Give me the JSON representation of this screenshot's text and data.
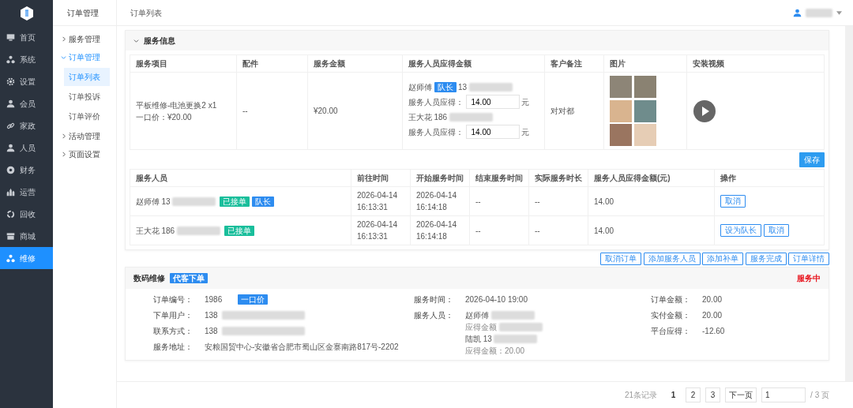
{
  "sidebar": {
    "items": [
      {
        "label": "首页",
        "selected": false
      },
      {
        "label": "系统",
        "selected": false
      },
      {
        "label": "设置",
        "selected": false
      },
      {
        "label": "会员",
        "selected": false
      },
      {
        "label": "家政",
        "selected": false
      },
      {
        "label": "人员",
        "selected": false
      },
      {
        "label": "财务",
        "selected": false
      },
      {
        "label": "运营",
        "selected": false
      },
      {
        "label": "回收",
        "selected": false
      },
      {
        "label": "商城",
        "selected": false
      },
      {
        "label": "维修",
        "selected": true
      }
    ]
  },
  "submenu": {
    "title": "订单管理",
    "groups": [
      {
        "label": "服务管理",
        "expanded": false
      },
      {
        "label": "订单管理",
        "expanded": true,
        "children": [
          {
            "label": "订单列表",
            "selected": true
          },
          {
            "label": "订单投诉",
            "selected": false
          },
          {
            "label": "订单评价",
            "selected": false
          }
        ]
      },
      {
        "label": "活动管理",
        "expanded": false
      },
      {
        "label": "页面设置",
        "expanded": false
      }
    ]
  },
  "breadcrumb": "订单列表",
  "user": {
    "redacted": true
  },
  "service_info": {
    "title": "服务信息",
    "expanded": true,
    "items_table": {
      "columns": [
        "服务项目",
        "配件",
        "服务金额",
        "服务人员应得金额",
        "客户备注",
        "图片",
        "安装视频"
      ],
      "row": {
        "item": "平板维修-电池更换2 x1",
        "price": "一口价：¥20.00",
        "parts": "--",
        "amount": "¥20.00",
        "note": "对对都",
        "earnings": [
          {
            "name": "赵师傅",
            "leader": true,
            "leader_label": "队长",
            "phone": "13",
            "redacted": true,
            "label": "服务人员应得：",
            "value": "14.00",
            "unit": "元"
          },
          {
            "name": "王大花",
            "leader": false,
            "phone": "186",
            "redacted": true,
            "label": "服务人员应得：",
            "value": "14.00",
            "unit": "元"
          }
        ]
      }
    },
    "save_button": "保存",
    "staff_table": {
      "columns": [
        "服务人员",
        "前往时间",
        "开始服务时间",
        "结束服务时间",
        "实际服务时长",
        "服务人员应得金额(元)",
        "操作"
      ],
      "rows": [
        {
          "name": "赵师傅",
          "phone": "13",
          "redacted": true,
          "tags": [
            {
              "label": "已接单",
              "kind": "accepted"
            },
            {
              "label": "队长",
              "kind": "leader"
            }
          ],
          "depart": [
            "2026-04-14",
            "16:13:31"
          ],
          "start": [
            "2026-04-14",
            "16:14:18"
          ],
          "end": "--",
          "duration": "--",
          "earn": "14.00",
          "actions": [
            "取消"
          ]
        },
        {
          "name": "王大花",
          "phone": "186",
          "redacted": true,
          "tags": [
            {
              "label": "已接单",
              "kind": "accepted"
            }
          ],
          "depart": [
            "2026-04-14",
            "16:13:31"
          ],
          "start": [
            "2026-04-14",
            "16:14:18"
          ],
          "end": "--",
          "duration": "--",
          "earn": "14.00",
          "actions": [
            "设为队长",
            "取消"
          ]
        }
      ]
    }
  },
  "order_actions": [
    "取消订单",
    "添加服务人员",
    "添加补单",
    "服务完成",
    "订单详情"
  ],
  "order": {
    "category": "数码维修",
    "tag": "代客下单",
    "status": "服务中",
    "col1": [
      {
        "label": "订单编号：",
        "value": "1986",
        "badge": "一口价"
      },
      {
        "label": "下单用户：",
        "value": "138",
        "redacted": true
      },
      {
        "label": "联系方式：",
        "value": "138",
        "redacted": true
      },
      {
        "label": "服务地址：",
        "value": "安粮国贸中心-安徽省合肥市蜀山区金寨南路817号-2202"
      }
    ],
    "col2": [
      {
        "label": "服务时间：",
        "lines": [
          {
            "text": "2026-04-10 19:00"
          }
        ]
      },
      {
        "label": "服务人员：",
        "lines": [
          {
            "text": "赵师傅",
            "redacted": true
          },
          {
            "text": "应得金额",
            "redacted": true,
            "muted": true
          },
          {
            "text": "陆凯  13",
            "redacted": true
          },
          {
            "text": "应得金额：20.00",
            "muted": true
          }
        ]
      }
    ],
    "col3": [
      {
        "label": "订单金额：",
        "value": "20.00"
      },
      {
        "label": "实付金额：",
        "value": "20.00"
      },
      {
        "label": "平台应得：",
        "value": "-12.60"
      }
    ]
  },
  "pagination": {
    "total": "21条记录",
    "pages": [
      {
        "label": "1",
        "selected": true
      },
      {
        "label": "2",
        "selected": false
      },
      {
        "label": "3",
        "selected": false
      }
    ],
    "next": "下一页",
    "page_input": "1",
    "page_total": "/ 3 页"
  }
}
